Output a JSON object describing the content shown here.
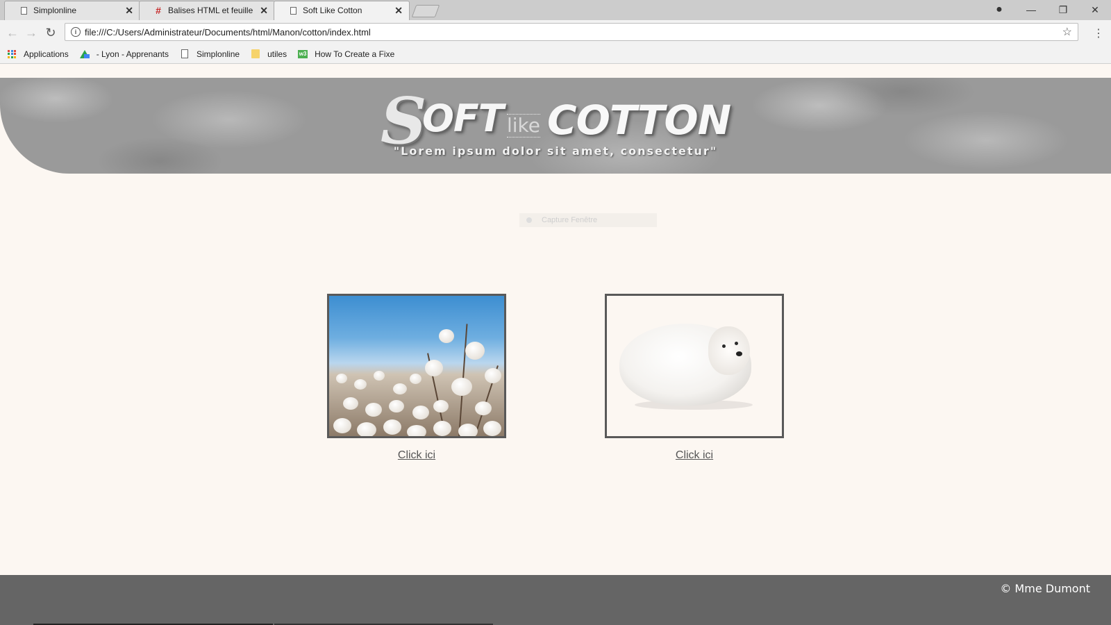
{
  "tabs": [
    {
      "label": "Simplonline",
      "icon": "page-icon",
      "close": "✕"
    },
    {
      "label": "Balises HTML et feuille de",
      "icon": "hash-icon",
      "close": "✕"
    },
    {
      "label": "Soft Like Cotton",
      "icon": "page-icon",
      "close": "✕"
    }
  ],
  "window_controls": {
    "account": "●",
    "minimize": "—",
    "restore": "❐",
    "close": "✕"
  },
  "toolbar": {
    "back": "←",
    "forward": "→",
    "reload": "↻",
    "info": "i",
    "url": "file:///C:/Users/Administrateur/Documents/html/Manon/cotton/index.html",
    "star": "☆",
    "menu": "⋮"
  },
  "bookmarks": [
    {
      "label": "Applications",
      "icon": "apps-grid-icon"
    },
    {
      "label": "- Lyon - Apprenants",
      "icon": "google-drive-icon"
    },
    {
      "label": "Simplonline",
      "icon": "page-icon"
    },
    {
      "label": "utiles",
      "icon": "folder-icon"
    },
    {
      "label": "How To Create a Fixe",
      "icon": "w3schools-icon"
    }
  ],
  "site": {
    "logo": {
      "s": "S",
      "oft": "OFT",
      "like": "like",
      "cotton": "COTTON"
    },
    "tagline": "\"Lorem ipsum dolor sit amet, consectetur\"",
    "overlay": "Capture Fenêtre",
    "cards": [
      {
        "image": "cotton-field",
        "link": "Click ici"
      },
      {
        "image": "white-fluffy-dog",
        "link": "Click ici"
      }
    ],
    "footer": "© Mme Dumont"
  },
  "colors": {
    "banner": "#9a9a9a",
    "page_bg": "#fcf7f2",
    "footer": "#656565",
    "frame": "#595959"
  }
}
